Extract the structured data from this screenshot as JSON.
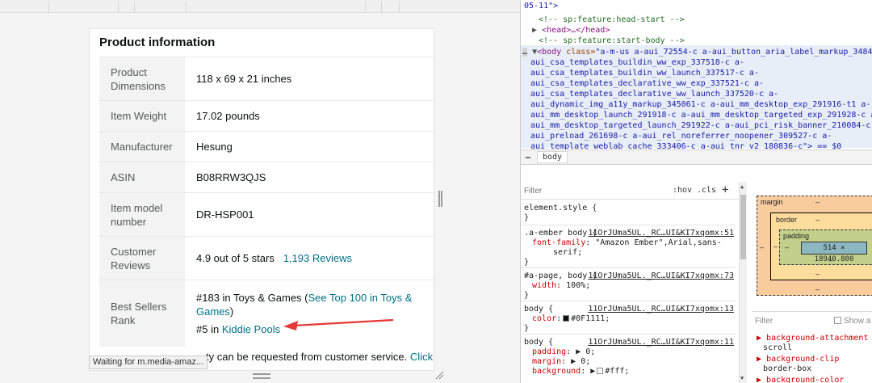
{
  "page": {
    "card_title": "Product information",
    "rows": [
      {
        "label": "Product Dimensions",
        "value": "118 x 69 x 21 inches"
      },
      {
        "label": "Item Weight",
        "value": "17.02 pounds"
      },
      {
        "label": "Manufacturer",
        "value": "Hesung"
      },
      {
        "label": "ASIN",
        "value": "B08RRW3QJS"
      },
      {
        "label": "Item model number",
        "value": "DR-HSP001"
      },
      {
        "label": "Customer Reviews",
        "value": "4.9 out of 5 stars",
        "link": "1,193 Reviews"
      },
      {
        "label": "Best Sellers Rank",
        "rank1_prefix": "#183 in Toys & Games (",
        "rank1_link": "See Top 100 in Toys & Games",
        "rank1_suffix": ")",
        "rank2_prefix": "#5 in ",
        "rank2_link": "Kiddie Pools"
      }
    ],
    "tail_text": "ty can be requested from customer service.",
    "tail_link": "Click",
    "status": "Waiting for m.media-amaz...",
    "arrow_color": "#e53935"
  },
  "devtools": {
    "elements": {
      "line0": "05-11\">",
      "comment_head_start": "<!-- sp:feature:head-start -->",
      "head_collapsed": "<head>…</head>",
      "comment_start_body": "<!-- sp:feature:start-body -->",
      "body_tag": "<body ",
      "body_attr": "class=",
      "body_class_lines": [
        "\"a-m-us a-aui_72554-c a-aui_button_aria_label_markup_348458-c a-",
        "aui_csa_templates_buildin_ww_exp_337518-c a-",
        "aui_csa_templates_buildin_ww_launch_337517-c a-",
        "aui_csa_templates_declarative_ww_exp_337521-c a-",
        "aui_csa_templates_declarative_ww_launch_337520-c a-",
        "aui_dynamic_img_a11y_markup_345061-c a-aui_mm_desktop_exp_291916-t1 a-",
        "aui_mm_desktop_launch_291918-c a-aui_mm_desktop_targeted_exp_291928-c a-",
        "aui_mm_desktop_targeted_launch_291922-c a-aui_pci_risk_banner_210084-c a-",
        "aui_preload_261698-c a-aui_rel_noreferrer_noopener_309527-c a-",
        "aui_template_weblab_cache_333406-c a-aui_tnr_v2_180836-c\"> == $0"
      ]
    },
    "breadcrumb": {
      "dots": "…",
      "current": "body"
    },
    "styles": {
      "filter_placeholder": "Filter",
      "hov": ":hov",
      "cls": ".cls",
      "plus": "+",
      "element_style": "element.style {",
      "close_brace": "}",
      "rule1_selector": ".a-ember body {",
      "rule1_src": "11OrJUma5UL._RC…UI&KI7xqomx:51",
      "rule1_prop": "font-family",
      "rule1_val": ": \"Amazon Ember\",Arial,sans-",
      "rule1_val2": "serif;",
      "rule2_selector": "#a-page, body {",
      "rule2_src": "11OrJUma5UL._RC…UI&KI7xqomx:73",
      "rule2_prop": "width",
      "rule2_val": ": 100%;",
      "rule3_selector": "body {",
      "rule3_src": "11OrJUma5UL._RC…UI&KI7xqomx:13",
      "rule3_prop": "color",
      "rule3_val": "#0F1111;",
      "rule4_selector": "body {",
      "rule4_src": "11OrJUma5UL._RC…UI&KI7xqomx:11",
      "rule4_prop1": "padding",
      "rule4_val1": "▶ 0;",
      "rule4_prop2": "margin",
      "rule4_val2": "▶ 0;",
      "rule4_prop3": "background",
      "rule4_val3": "#fff;"
    },
    "boxmodel": {
      "margin_label": "margin",
      "border_label": "border",
      "padding_label": "padding",
      "dash": "–",
      "content": "514 × 18940.800"
    },
    "computed": {
      "filter_placeholder": "Filter",
      "show_all": "Show a",
      "props": [
        {
          "name": "background-attachment",
          "value": "scroll"
        },
        {
          "name": "background-clip",
          "value": "border-box"
        },
        {
          "name": "background-color",
          "value": ""
        }
      ]
    }
  }
}
